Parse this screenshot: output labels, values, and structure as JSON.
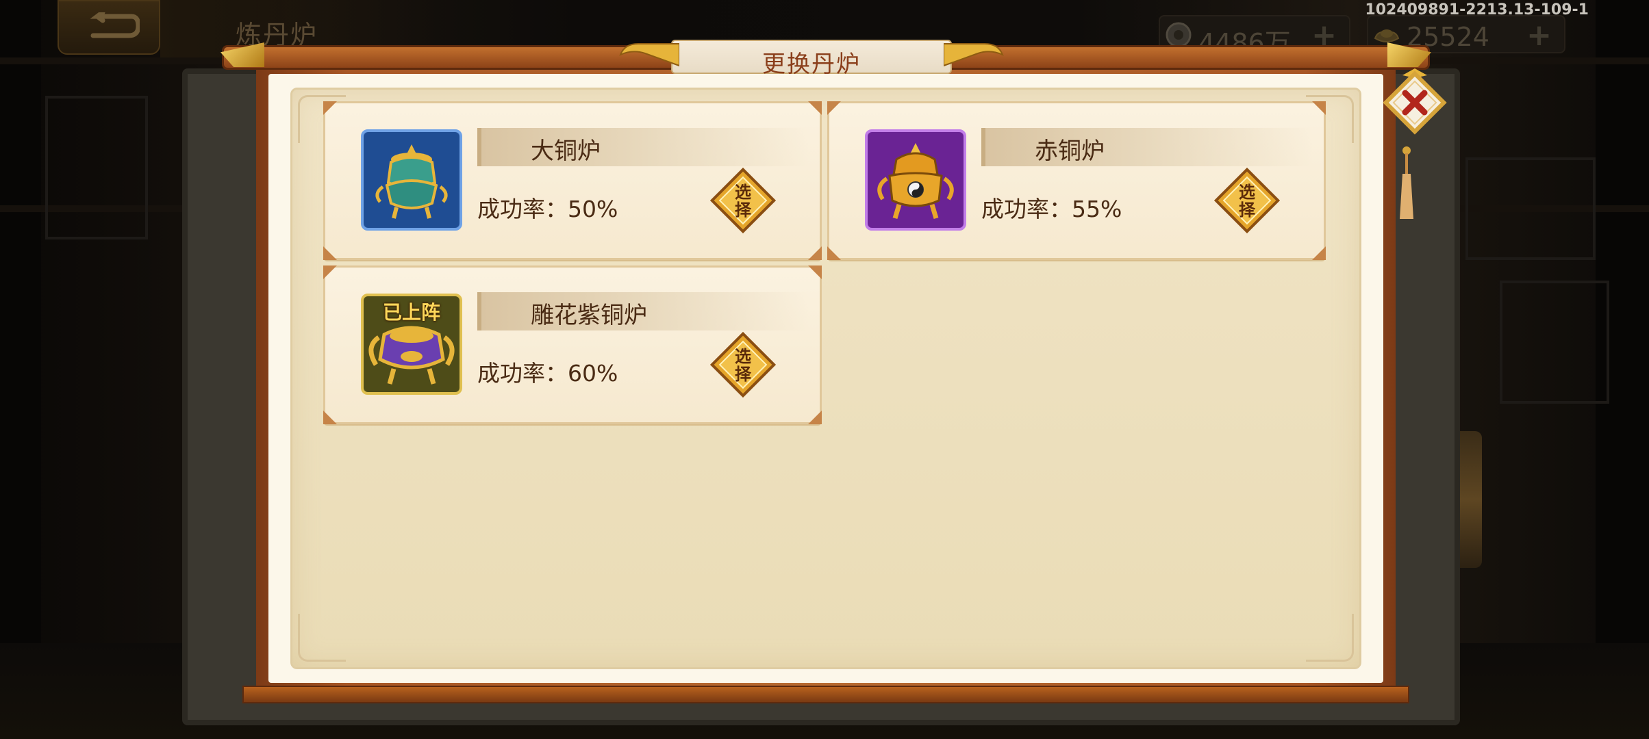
{
  "build_id": "102409891-2213.13-109-1",
  "page_title": "炼丹炉",
  "resources": [
    {
      "icon": "coin-icon",
      "value": "4486万",
      "plus": "+"
    },
    {
      "icon": "ingot-icon",
      "value": "25524",
      "plus": "+"
    }
  ],
  "dialog": {
    "title": "更换丹炉",
    "furnaces": [
      {
        "name": "大铜炉",
        "rate": "成功率：50%",
        "icon": "teal-bronze-furnace-icon",
        "frame_color": "#2f6fc4",
        "select_label": "选择"
      },
      {
        "name": "赤铜炉",
        "rate": "成功率：55%",
        "icon": "golden-furnace-icon",
        "frame_color": "#9b3fd0",
        "select_label": "选择"
      },
      {
        "name": "雕花紫铜炉",
        "rate": "成功率：60%",
        "icon": "purple-ornate-furnace-icon",
        "frame_color": "#d7b33a",
        "badge": "已上阵",
        "select_label": "选择"
      }
    ]
  },
  "colors": {
    "accent": "#b86a30",
    "gold": "#e9b53a",
    "parchment": "#f0e4c6",
    "text": "#4a2b14"
  }
}
